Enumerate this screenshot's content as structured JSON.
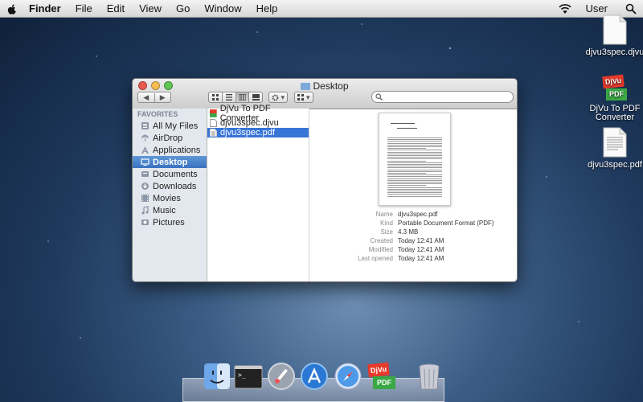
{
  "menubar": {
    "app_name": "Finder",
    "items": [
      "File",
      "Edit",
      "View",
      "Go",
      "Window",
      "Help"
    ],
    "user": "User"
  },
  "desktop_icons": [
    {
      "label": "djvu3spec.djvu",
      "icon": "document-icon"
    },
    {
      "label": "DjVu To PDF Converter",
      "icon": "djvu-converter-app-icon",
      "badge_top": "DjVu",
      "badge_bottom": "PDF"
    },
    {
      "label": "djvu3spec.pdf",
      "icon": "pdf-document-icon"
    }
  ],
  "window": {
    "title": "Desktop",
    "nav_back": "◀",
    "nav_forward": "▶",
    "sidebar": {
      "header": "FAVORITES",
      "items": [
        {
          "label": "All My Files",
          "icon": "all-files-icon"
        },
        {
          "label": "AirDrop",
          "icon": "airdrop-icon"
        },
        {
          "label": "Applications",
          "icon": "applications-icon"
        },
        {
          "label": "Desktop",
          "icon": "desktop-icon",
          "selected": true
        },
        {
          "label": "Documents",
          "icon": "documents-icon"
        },
        {
          "label": "Downloads",
          "icon": "downloads-icon"
        },
        {
          "label": "Movies",
          "icon": "movies-icon"
        },
        {
          "label": "Music",
          "icon": "music-icon"
        },
        {
          "label": "Pictures",
          "icon": "pictures-icon"
        }
      ]
    },
    "files": [
      {
        "name": "DjVu To PDF Converter",
        "icon": "app-icon"
      },
      {
        "name": "djvu3spec.djvu",
        "icon": "document-icon"
      },
      {
        "name": "djvu3spec.pdf",
        "icon": "pdf-icon",
        "selected": true
      }
    ],
    "preview": {
      "labels": {
        "name": "Name",
        "kind": "Kind",
        "size": "Size",
        "created": "Created",
        "modified": "Modified",
        "last_opened": "Last opened"
      },
      "values": {
        "name": "djvu3spec.pdf",
        "kind": "Portable Document Format (PDF)",
        "size": "4.3 MB",
        "created": "Today 12:41 AM",
        "modified": "Today 12:41 AM",
        "last_opened": "Today 12:41 AM"
      }
    }
  },
  "dock": [
    {
      "name": "finder-dock-icon"
    },
    {
      "name": "terminal-dock-icon",
      "text": ">_"
    },
    {
      "name": "launchpad-dock-icon"
    },
    {
      "name": "app-store-dock-icon"
    },
    {
      "name": "safari-dock-icon"
    },
    {
      "name": "djvu-converter-dock-icon",
      "badge_top": "DjVu",
      "badge_bottom": "PDF"
    },
    {
      "name": "trash-dock-icon"
    }
  ],
  "colors": {
    "selection": "#3875d7",
    "sidebar_bg": "#e3e8ee",
    "close": "#ea5a4f",
    "minimize": "#f5be4f",
    "maximize": "#62c554",
    "djvu_red": "#e63a2a",
    "pdf_green": "#3aa845"
  }
}
